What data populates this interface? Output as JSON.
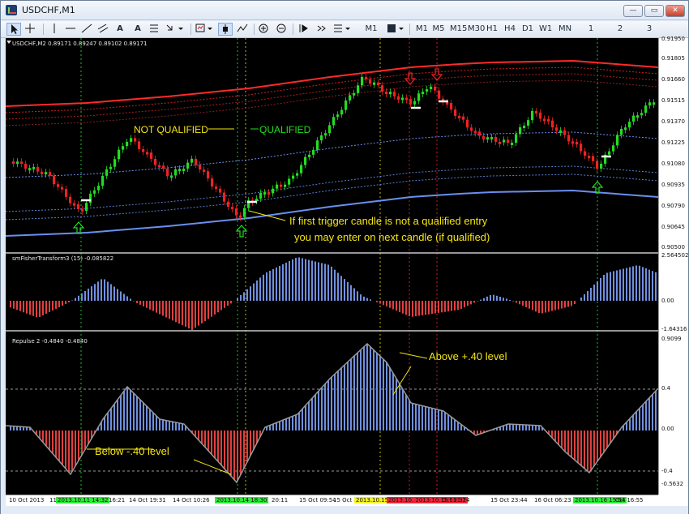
{
  "window": {
    "title": "USDCHF,M1",
    "btn_min": "—",
    "btn_max": "▭",
    "btn_close": "✕"
  },
  "toolbar": {
    "periods": [
      "M1",
      "M5",
      "M15",
      "M30",
      "H1",
      "H4",
      "D1",
      "W1",
      "MN"
    ],
    "period_menu": "M1",
    "template_menu": "",
    "tabs": [
      "1",
      "2",
      "3"
    ]
  },
  "main_pane": {
    "header": "USDCHF,M2  0.89171 0.89247 0.89102 0.89171",
    "price_ticks": [
      "0.91950",
      "0.91805",
      "0.91660",
      "0.91515",
      "0.91370",
      "0.91225",
      "0.91080",
      "0.90935",
      "0.90790",
      "0.90645",
      "0.90500"
    ],
    "annotations": {
      "not_qualified": "NOT QUALIFIED",
      "qualified": "QUALIFIED",
      "trigger_line1": "If first trigger candle is not a qualified entry",
      "trigger_line2": "you may enter on next candle (if qualified)"
    }
  },
  "fisher_pane": {
    "header": "smFisherTransform3 (15) -0.085822",
    "ticks": [
      "2.564502",
      "0.00",
      "-1.64316"
    ]
  },
  "repulse_pane": {
    "header": "Repulse 2 -0.4840 -0.4840",
    "ticks": [
      "0.9099",
      "0.4",
      "0.00",
      "-0.4",
      "-0.5632"
    ],
    "annotations": {
      "above": "Above +.40 level",
      "below": "Below -.40 level"
    }
  },
  "time_axis": [
    {
      "label": "10 Oct 2013",
      "hl": ""
    },
    {
      "label": "11",
      "hl": ""
    },
    {
      "label": "2013.10.11 14:32",
      "hl": "#2eea3a"
    },
    {
      "label": "16:21",
      "hl": ""
    },
    {
      "label": "14 Oct 19:31",
      "hl": ""
    },
    {
      "label": "14 Oct 10:26",
      "hl": ""
    },
    {
      "label": "2013.10.14 18:30",
      "hl": "#2eea3a"
    },
    {
      "label": "20:11",
      "hl": ""
    },
    {
      "label": "15 Oct 09:54",
      "hl": ""
    },
    {
      "label": "15 Oct 11:36",
      "hl": ""
    },
    {
      "label": "2013.10.15",
      "hl": "#f4f228"
    },
    {
      "label": "2013.10.  2013.10.15 19:37",
      "hl": "#e8283a"
    },
    {
      "label": "Oct 21:24",
      "hl": ""
    },
    {
      "label": "15 Oct 23:44",
      "hl": ""
    },
    {
      "label": "16 Oct 06:23",
      "hl": ""
    },
    {
      "label": "2013.10.16 15:54",
      "hl": "#2eea3a"
    },
    {
      "label": "Oct 16:55",
      "hl": ""
    }
  ],
  "colors": {
    "bull": "#22dd22",
    "bear": "#ee2222",
    "fisher_pos": "#7090e0",
    "fisher_neg": "#e04040",
    "band_outer": "#ff2a2a",
    "band_lower": "#6a8ff0",
    "annotation_yellow": "#f5e60f"
  },
  "chart_data": {
    "type": "candlestick",
    "symbol": "USDCHF",
    "timeframe": "M2",
    "ylim": [
      0.905,
      0.9195
    ],
    "fisher": {
      "ylim": [
        -1.64316,
        2.564502
      ]
    },
    "repulse": {
      "ylim": [
        -0.5632,
        0.9099
      ],
      "levels": [
        0.4,
        -0.4
      ]
    }
  }
}
